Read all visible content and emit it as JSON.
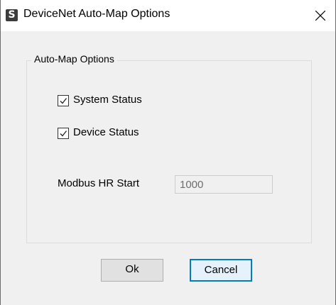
{
  "window": {
    "title": "DeviceNet Auto-Map Options",
    "app_icon_letter": "S",
    "close_symbol": "✕"
  },
  "group": {
    "legend": "Auto-Map Options"
  },
  "checkboxes": [
    {
      "label": "System Status",
      "checked": true
    },
    {
      "label": "Device Status",
      "checked": true
    }
  ],
  "modbus": {
    "label": "Modbus HR Start",
    "value": "1000",
    "disabled": true
  },
  "buttons": {
    "ok_label": "Ok",
    "cancel_label": "Cancel"
  },
  "colors": {
    "dialog_bg": "#f0f0f0",
    "focus_accent": "#0078d7"
  }
}
